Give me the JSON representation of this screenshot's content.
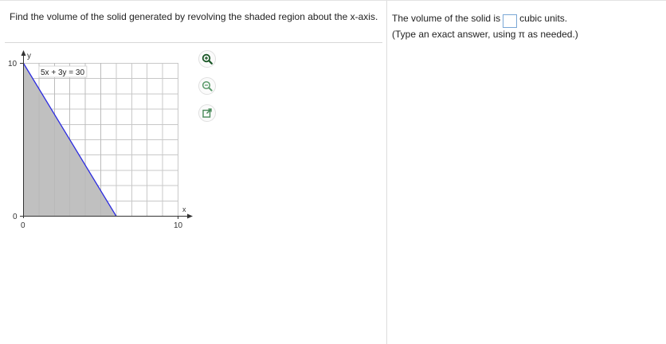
{
  "question": {
    "text": "Find the volume of the solid generated by revolving the shaded region about the x-axis."
  },
  "graph": {
    "equation_label": "5x + 3y = 30",
    "y_axis_label": "y",
    "x_axis_label": "x",
    "y_tick_top": "10",
    "y_tick_zero": "0",
    "x_tick_zero": "0",
    "x_tick_right": "10",
    "x_range": [
      0,
      10
    ],
    "y_range": [
      0,
      10
    ],
    "line_intercepts": {
      "x": 6,
      "y": 10
    },
    "shade_color": "#c0c0c0",
    "line_color": "#2a2ae0",
    "grid_color": "#c8c8c8"
  },
  "tools": {
    "zoom_in": "zoom-in-icon",
    "zoom_out": "zoom-out-icon",
    "popout": "popout-icon"
  },
  "answer": {
    "prefix": "The volume of the solid is",
    "suffix": "cubic units.",
    "input_value": "",
    "hint": "(Type an exact answer, using π as needed.)"
  }
}
